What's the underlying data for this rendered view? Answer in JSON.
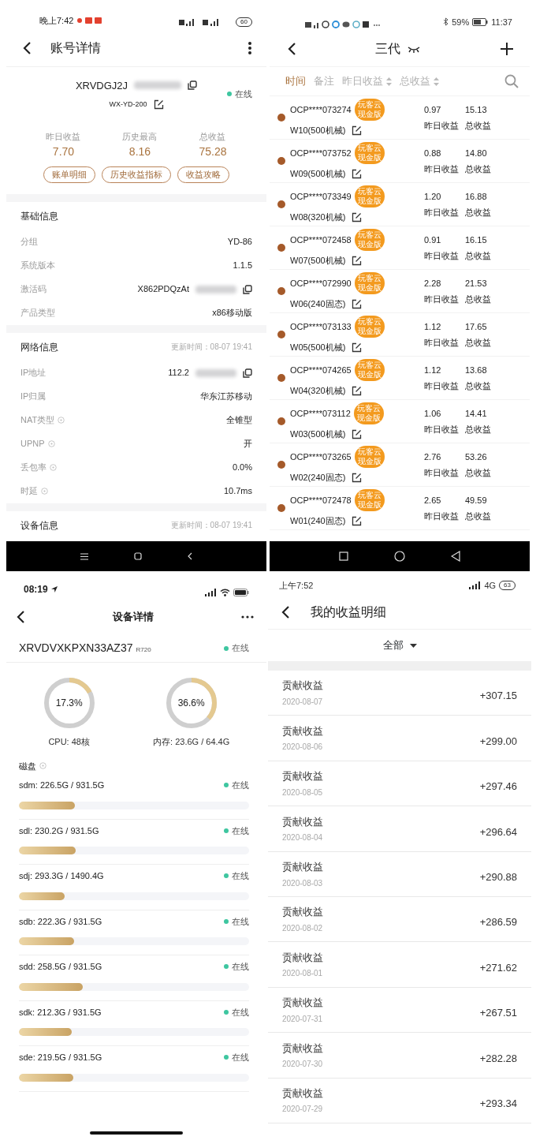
{
  "account_panel": {
    "status_bar": {
      "time": "晚上7:42",
      "battery": "60"
    },
    "title": "账号详情",
    "device_id": "XRVDGJ2J",
    "id_blurred": true,
    "remark": "WX-YD-200",
    "status": "在线",
    "stats": [
      {
        "label": "昨日收益",
        "value": "7.70"
      },
      {
        "label": "历史最高",
        "value": "8.16"
      },
      {
        "label": "总收益",
        "value": "75.28"
      }
    ],
    "buttons": [
      "账单明细",
      "历史收益指标",
      "收益攻略"
    ],
    "sections": [
      {
        "title": "基础信息",
        "rows": [
          {
            "label": "分组",
            "value": "YD-86",
            "help": false,
            "blurred": false,
            "copy": false
          },
          {
            "label": "系统版本",
            "value": "1.1.5",
            "help": false,
            "blurred": false,
            "copy": false
          },
          {
            "label": "激活码",
            "value": "X862PDQzAt",
            "help": false,
            "blurred": true,
            "copy": true
          },
          {
            "label": "产品类型",
            "value": "x86移动版",
            "help": false,
            "blurred": false,
            "copy": false
          }
        ]
      },
      {
        "title": "网络信息",
        "updated": "更新时间：08-07 19:41",
        "rows": [
          {
            "label": "IP地址",
            "value": "112.2",
            "help": false,
            "blurred": true,
            "copy": true
          },
          {
            "label": "IP归属",
            "value": "华东江苏移动",
            "help": false,
            "blurred": false,
            "copy": false
          },
          {
            "label": "NAT类型",
            "value": "全锥型",
            "help": true,
            "blurred": false,
            "copy": false
          },
          {
            "label": "UPNP",
            "value": "开",
            "help": true,
            "blurred": false,
            "copy": false
          },
          {
            "label": "丢包率",
            "value": "0.0%",
            "help": true,
            "blurred": false,
            "copy": false
          },
          {
            "label": "时延",
            "value": "10.7ms",
            "help": true,
            "blurred": false,
            "copy": false
          }
        ]
      },
      {
        "title": "设备信息",
        "updated": "更新时间：08-07 19:41"
      }
    ]
  },
  "node_list_panel": {
    "status_bar": {
      "battery": "59%",
      "time": "11:37"
    },
    "title": "三代",
    "sort_tabs": [
      {
        "label": "时间",
        "selected": true,
        "sortable": false
      },
      {
        "label": "备注",
        "selected": false,
        "sortable": false
      },
      {
        "label": "昨日收益",
        "selected": false,
        "sortable": true
      },
      {
        "label": "总收益",
        "selected": false,
        "sortable": true
      }
    ],
    "nodes": [
      {
        "id": "OCP****073274",
        "badge": [
          "玩客云",
          "现金版"
        ],
        "remark": "W10(500机械)",
        "yesterday": "0.97",
        "yesterday_label": "昨日收益",
        "total": "15.13",
        "total_label": "总收益"
      },
      {
        "id": "OCP****073752",
        "badge": [
          "玩客云",
          "现金版"
        ],
        "remark": "W09(500机械)",
        "yesterday": "0.88",
        "yesterday_label": "昨日收益",
        "total": "14.80",
        "total_label": "总收益"
      },
      {
        "id": "OCP****073349",
        "badge": [
          "玩客云",
          "现金版"
        ],
        "remark": "W08(320机械)",
        "yesterday": "1.20",
        "yesterday_label": "昨日收益",
        "total": "16.88",
        "total_label": "总收益"
      },
      {
        "id": "OCP****072458",
        "badge": [
          "玩客云",
          "现金版"
        ],
        "remark": "W07(500机械)",
        "yesterday": "0.91",
        "yesterday_label": "昨日收益",
        "total": "16.15",
        "total_label": "总收益"
      },
      {
        "id": "OCP****072990",
        "badge": [
          "玩客云",
          "现金版"
        ],
        "remark": "W06(240固态)",
        "yesterday": "2.28",
        "yesterday_label": "昨日收益",
        "total": "21.53",
        "total_label": "总收益"
      },
      {
        "id": "OCP****073133",
        "badge": [
          "玩客云",
          "现金版"
        ],
        "remark": "W05(500机械)",
        "yesterday": "1.12",
        "yesterday_label": "昨日收益",
        "total": "17.65",
        "total_label": "总收益"
      },
      {
        "id": "OCP****074265",
        "badge": [
          "玩客云",
          "现金版"
        ],
        "remark": "W04(320机械)",
        "yesterday": "1.12",
        "yesterday_label": "昨日收益",
        "total": "13.68",
        "total_label": "总收益"
      },
      {
        "id": "OCP****073112",
        "badge": [
          "玩客云",
          "现金版"
        ],
        "remark": "W03(500机械)",
        "yesterday": "1.06",
        "yesterday_label": "昨日收益",
        "total": "14.41",
        "total_label": "总收益"
      },
      {
        "id": "OCP****073265",
        "badge": [
          "玩客云",
          "现金版"
        ],
        "remark": "W02(240固态)",
        "yesterday": "2.76",
        "yesterday_label": "昨日收益",
        "total": "53.26",
        "total_label": "总收益"
      },
      {
        "id": "OCP****072478",
        "badge": [
          "玩客云",
          "现金版"
        ],
        "remark": "W01(240固态)",
        "yesterday": "2.65",
        "yesterday_label": "昨日收益",
        "total": "49.59",
        "total_label": "总收益"
      }
    ]
  },
  "device_panel": {
    "status_bar": {
      "time": "08:19"
    },
    "title": "设备详情",
    "device_id": "XRVDVXKPXN33AZ37",
    "model": "R720",
    "status": "在线",
    "gauges": [
      {
        "value": "17.3%",
        "level": 0.173,
        "caption": "CPU: 48核"
      },
      {
        "value": "36.6%",
        "level": 0.366,
        "caption": "内存: 23.6G / 64.4G"
      }
    ],
    "disks_title": "磁盘",
    "disks": [
      {
        "usage": "sdm: 226.5G / 931.5G",
        "status": "在线",
        "level": 0.243
      },
      {
        "usage": "sdl: 230.2G / 931.5G",
        "status": "在线",
        "level": 0.247
      },
      {
        "usage": "sdj: 293.3G / 1490.4G",
        "status": "在线",
        "level": 0.197
      },
      {
        "usage": "sdb: 222.3G / 931.5G",
        "status": "在线",
        "level": 0.239
      },
      {
        "usage": "sdd: 258.5G / 931.5G",
        "status": "在线",
        "level": 0.278
      },
      {
        "usage": "sdk: 212.3G / 931.5G",
        "status": "在线",
        "level": 0.228
      },
      {
        "usage": "sde: 219.5G / 931.5G",
        "status": "在线",
        "level": 0.236
      }
    ]
  },
  "earnings_panel": {
    "status_bar": {
      "time": "上午7:52",
      "network": "4G",
      "battery": "63"
    },
    "title": "我的收益明细",
    "filter": "全部",
    "items": [
      {
        "title": "贡献收益",
        "date": "2020-08-07",
        "amount": "+307.15"
      },
      {
        "title": "贡献收益",
        "date": "2020-08-06",
        "amount": "+299.00"
      },
      {
        "title": "贡献收益",
        "date": "2020-08-05",
        "amount": "+297.46"
      },
      {
        "title": "贡献收益",
        "date": "2020-08-04",
        "amount": "+296.64"
      },
      {
        "title": "贡献收益",
        "date": "2020-08-03",
        "amount": "+290.88"
      },
      {
        "title": "贡献收益",
        "date": "2020-08-02",
        "amount": "+286.59"
      },
      {
        "title": "贡献收益",
        "date": "2020-08-01",
        "amount": "+271.62"
      },
      {
        "title": "贡献收益",
        "date": "2020-07-31",
        "amount": "+267.51"
      },
      {
        "title": "贡献收益",
        "date": "2020-07-30",
        "amount": "+282.28"
      },
      {
        "title": "贡献收益",
        "date": "2020-07-29",
        "amount": "+293.34"
      }
    ]
  }
}
